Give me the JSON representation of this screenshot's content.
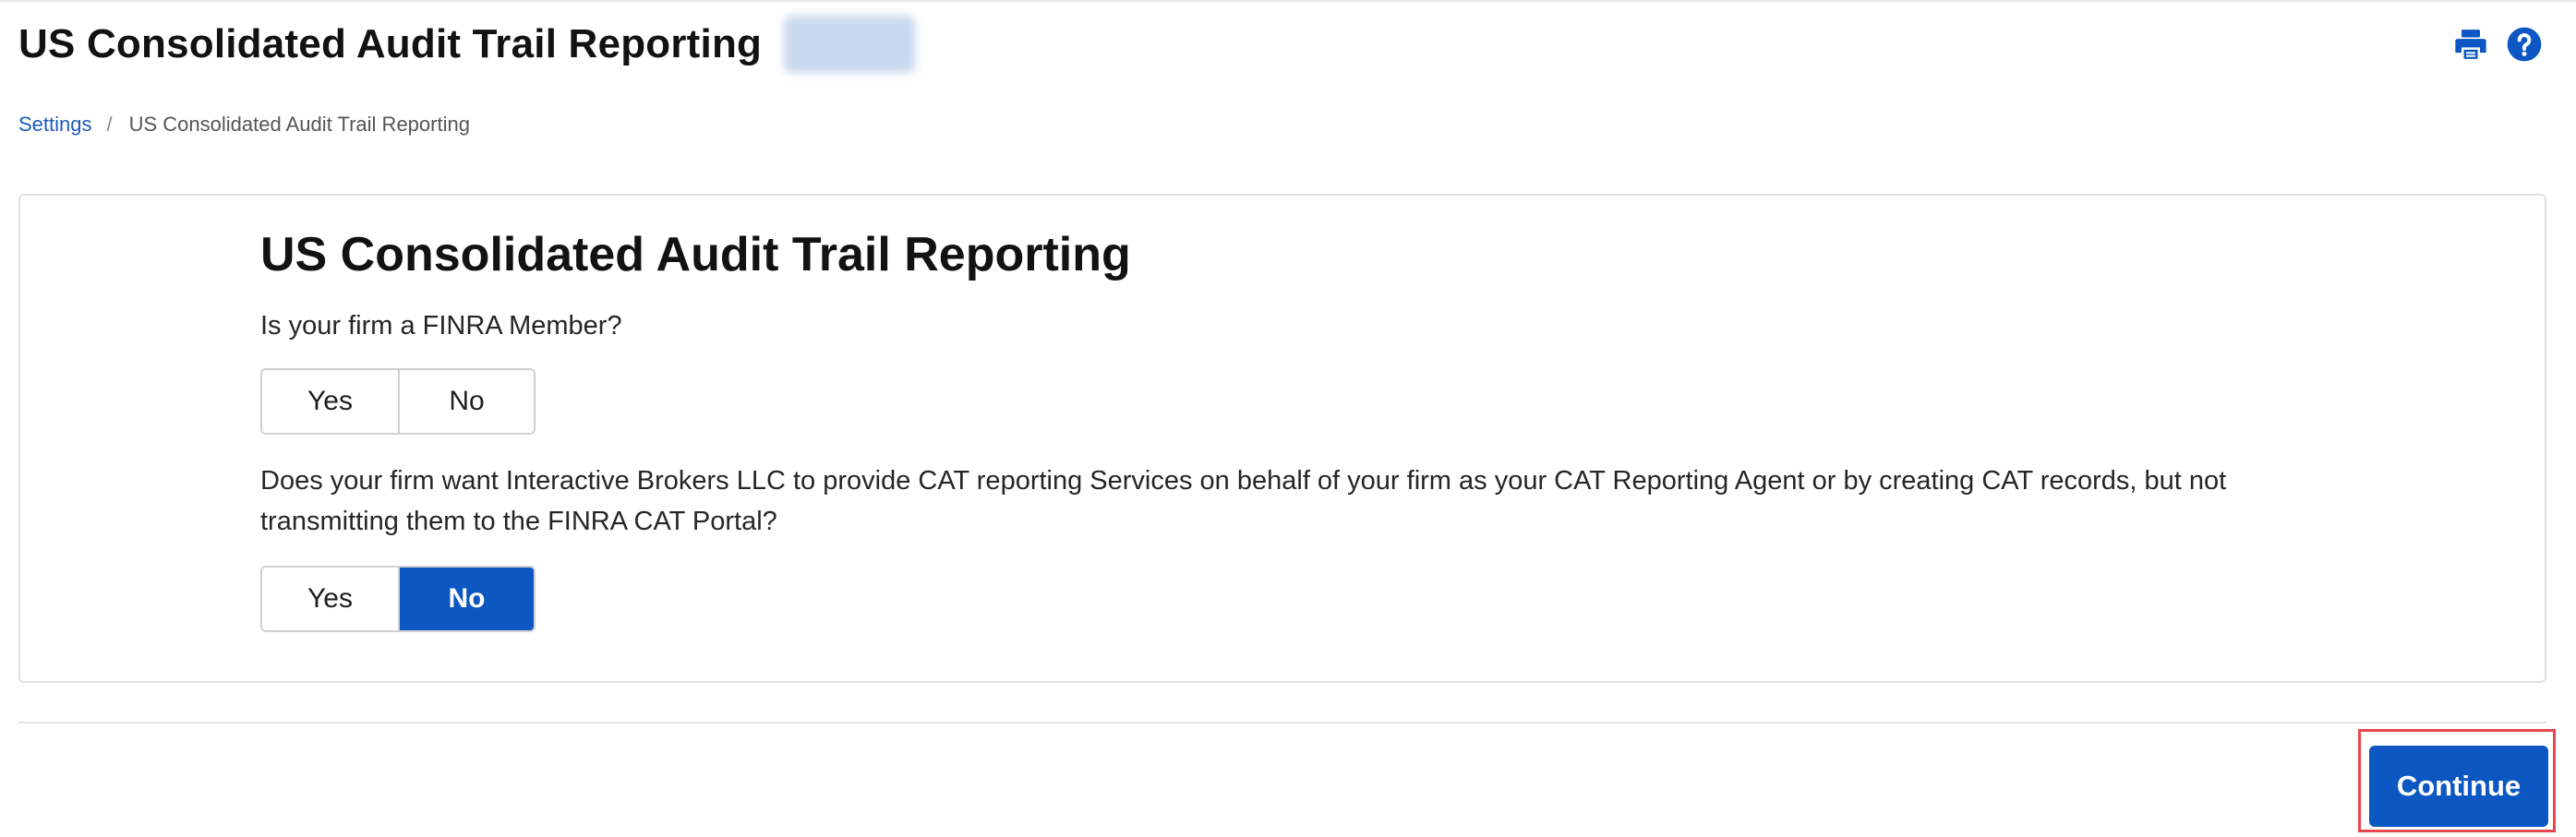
{
  "header": {
    "title": "US Consolidated Audit Trail Reporting",
    "tools": [
      {
        "icon": "print-icon",
        "color": "#0d57c2"
      },
      {
        "icon": "help-icon",
        "color": "#0d57c2"
      }
    ]
  },
  "breadcrumb": {
    "items": [
      "Settings"
    ],
    "separator": "/",
    "current": "US Consolidated Audit Trail Reporting"
  },
  "card": {
    "title": "US Consolidated Audit Trail Reporting",
    "questions": [
      {
        "text": "Is your firm a FINRA Member?",
        "options": [
          "Yes",
          "No"
        ],
        "selected": null
      },
      {
        "text": "Does your firm want Interactive Brokers LLC to provide CAT reporting Services on behalf of your firm as your CAT Reporting Agent or by creating CAT records, but not transmitting them to the FINRA CAT Portal?",
        "options": [
          "Yes",
          "No"
        ],
        "selected": "No"
      }
    ]
  },
  "footer": {
    "continue_label": "Continue"
  },
  "colors": {
    "accent": "#0d57c2",
    "link": "#1a5bbf",
    "highlight": "#e8484d"
  }
}
